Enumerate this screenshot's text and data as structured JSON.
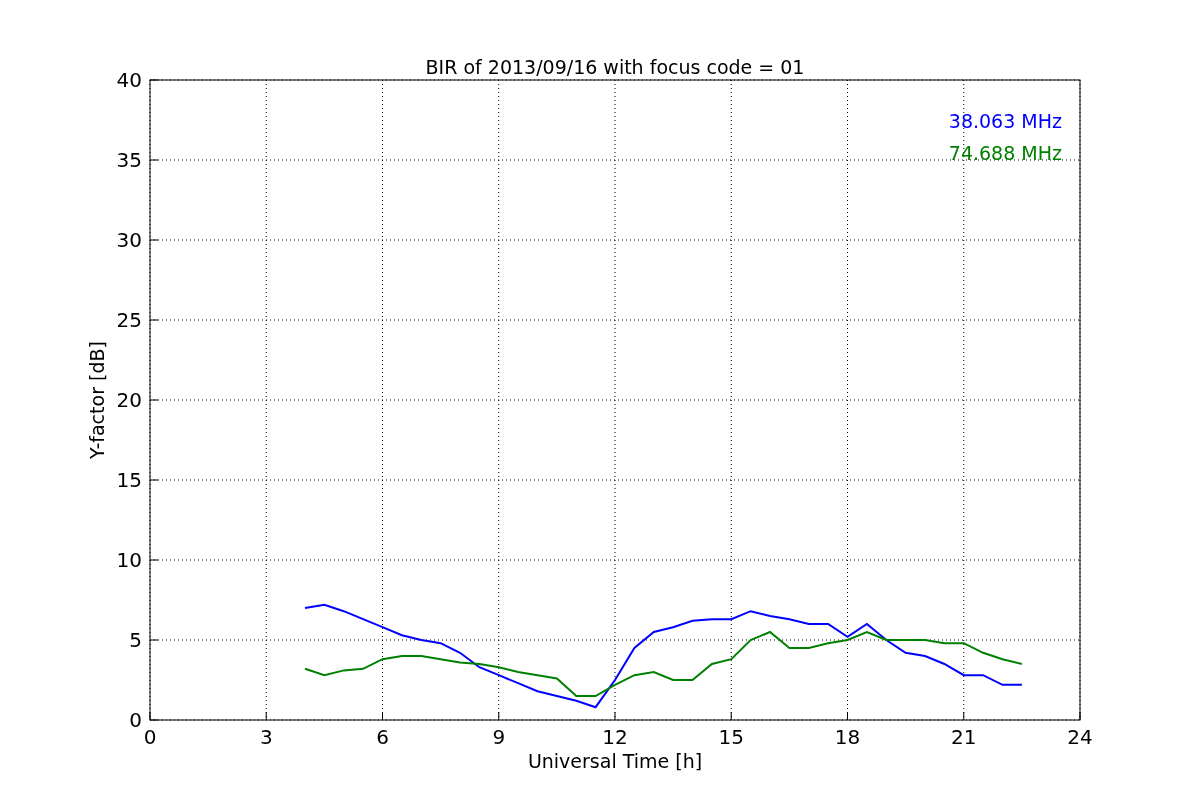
{
  "chart_data": {
    "type": "line",
    "title": "BIR of 2013/09/16 with focus code = 01",
    "xlabel": "Universal Time [h]",
    "ylabel": "Y-factor [dB]",
    "x": [
      4.0,
      4.5,
      5.0,
      5.5,
      6.0,
      6.5,
      7.0,
      7.5,
      8.0,
      8.5,
      9.0,
      9.5,
      10.0,
      10.5,
      11.0,
      11.5,
      12.0,
      12.5,
      13.0,
      13.5,
      14.0,
      14.5,
      15.0,
      15.5,
      16.0,
      16.5,
      17.0,
      17.5,
      18.0,
      18.5,
      19.0,
      19.5,
      20.0,
      20.5,
      21.0,
      21.5,
      22.0,
      22.5
    ],
    "series": [
      {
        "name": "38.063 MHz",
        "color": "#0000ff",
        "values": [
          7,
          7.2,
          6.8,
          6.3,
          5.8,
          5.3,
          5.0,
          4.8,
          4.2,
          3.3,
          2.8,
          2.3,
          1.8,
          1.5,
          1.2,
          0.8,
          2.5,
          4.5,
          5.5,
          5.8,
          6.2,
          6.3,
          6.3,
          6.8,
          6.5,
          6.3,
          6.0,
          6.0,
          5.2,
          6.0,
          5.0,
          4.2,
          4.0,
          3.5,
          2.8,
          2.8,
          2.2,
          2.2
        ]
      },
      {
        "name": "74.688 MHz",
        "color": "#008000",
        "values": [
          3.2,
          2.8,
          3.1,
          3.2,
          3.8,
          4.0,
          4.0,
          3.8,
          3.6,
          3.5,
          3.3,
          3.0,
          2.8,
          2.6,
          1.5,
          1.5,
          2.2,
          2.8,
          3.0,
          2.5,
          2.5,
          3.5,
          3.8,
          5.0,
          5.5,
          4.5,
          4.5,
          4.8,
          5.0,
          5.5,
          5.0,
          5.0,
          5.0,
          4.8,
          4.8,
          4.2,
          3.8,
          3.5
        ]
      }
    ],
    "grid": true,
    "xlim": [
      0,
      24
    ],
    "ylim": [
      0,
      40
    ],
    "xticks": [
      0,
      3,
      6,
      9,
      12,
      15,
      18,
      21,
      24
    ],
    "yticks": [
      0,
      5,
      10,
      15,
      20,
      25,
      30,
      35,
      40
    ]
  }
}
